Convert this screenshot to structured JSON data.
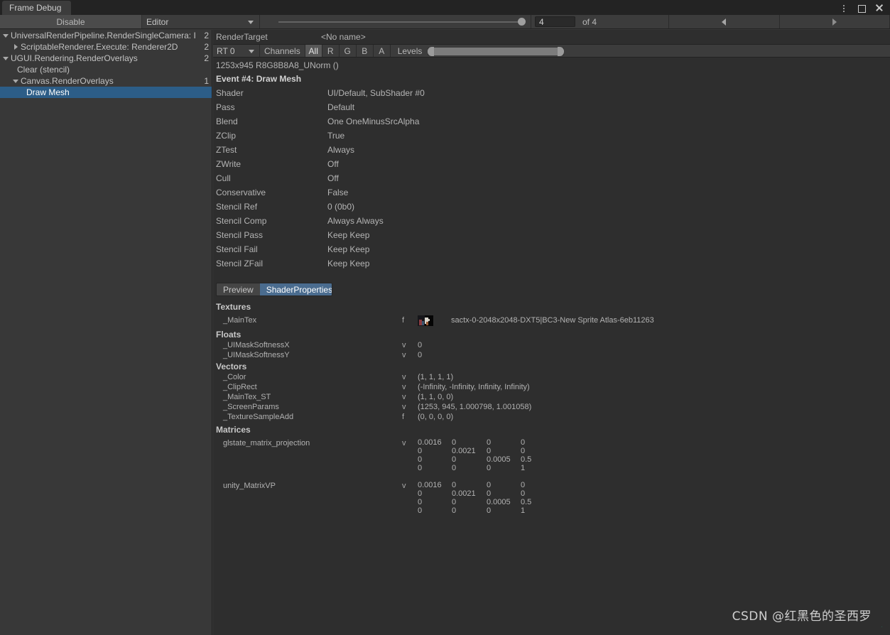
{
  "window": {
    "tab_title": "Frame Debug",
    "accent_color": "#19c39c",
    "selection_color": "#2c5d87",
    "panel_bg": "#2e2e2e",
    "buttons": {
      "menu": "kebab-menu",
      "maximize": "maximize",
      "close": "close"
    }
  },
  "toolbar": {
    "disable_label": "Disable",
    "target_label": "Editor",
    "event_index": "4",
    "event_total": "of 4",
    "prev_label": "◀",
    "next_label": "▶"
  },
  "tree": {
    "items": [
      {
        "label": "UniversalRenderPipeline.RenderSingleCamera: I",
        "count": "2",
        "indent": 0,
        "arrow": "down",
        "selected": false
      },
      {
        "label": "ScriptableRenderer.Execute: Renderer2D",
        "count": "2",
        "indent": 1,
        "arrow": "right",
        "selected": false
      },
      {
        "label": "UGUI.Rendering.RenderOverlays",
        "count": "2",
        "indent": 0,
        "arrow": "down",
        "selected": false
      },
      {
        "label": "Clear (stencil)",
        "count": "",
        "indent": 1,
        "arrow": "none",
        "selected": false
      },
      {
        "label": "Canvas.RenderOverlays",
        "count": "1",
        "indent": 1,
        "arrow": "down",
        "selected": false
      },
      {
        "label": "Draw Mesh",
        "count": "",
        "indent": 2,
        "arrow": "none",
        "selected": true
      }
    ]
  },
  "render_target": {
    "title": "RenderTarget",
    "name": "<No name>",
    "rt_select": "RT 0",
    "channels_label": "Channels",
    "channels": [
      "All",
      "R",
      "G",
      "B",
      "A"
    ],
    "channel_active": "All",
    "levels_label": "Levels",
    "info": "1253x945 R8G8B8A8_UNorm ()",
    "event_title": "Event #4: Draw Mesh"
  },
  "properties": [
    {
      "key": "Shader",
      "value": "UI/Default, SubShader #0"
    },
    {
      "key": "Pass",
      "value": "Default"
    },
    {
      "key": "Blend",
      "value": "One OneMinusSrcAlpha"
    },
    {
      "key": "ZClip",
      "value": "True"
    },
    {
      "key": "ZTest",
      "value": "Always"
    },
    {
      "key": "ZWrite",
      "value": "Off"
    },
    {
      "key": "Cull",
      "value": "Off"
    },
    {
      "key": "Conservative",
      "value": "False"
    },
    {
      "key": "Stencil Ref",
      "value": "0 (0b0)"
    },
    {
      "key": "Stencil Comp",
      "value": "Always Always"
    },
    {
      "key": "Stencil Pass",
      "value": "Keep Keep"
    },
    {
      "key": "Stencil Fail",
      "value": "Keep Keep"
    },
    {
      "key": "Stencil ZFail",
      "value": "Keep Keep"
    }
  ],
  "tabs": {
    "preview": "Preview",
    "shader_properties": "ShaderProperties",
    "active": "ShaderProperties"
  },
  "shader_properties": {
    "textures_header": "Textures",
    "textures": [
      {
        "name": "_MainTex",
        "type": "f",
        "value": "sactx-0-2048x2048-DXT5|BC3-New Sprite Atlas-6eb11263"
      }
    ],
    "floats_header": "Floats",
    "floats": [
      {
        "name": "_UIMaskSoftnessX",
        "type": "v",
        "value": "0"
      },
      {
        "name": "_UIMaskSoftnessY",
        "type": "v",
        "value": "0"
      }
    ],
    "vectors_header": "Vectors",
    "vectors": [
      {
        "name": "_Color",
        "type": "v",
        "value": "(1, 1, 1, 1)"
      },
      {
        "name": "_ClipRect",
        "type": "v",
        "value": "(-Infinity, -Infinity, Infinity, Infinity)"
      },
      {
        "name": "_MainTex_ST",
        "type": "v",
        "value": "(1, 1, 0, 0)"
      },
      {
        "name": "_ScreenParams",
        "type": "v",
        "value": "(1253, 945, 1.000798, 1.001058)"
      },
      {
        "name": "_TextureSampleAdd",
        "type": "f",
        "value": "(0, 0, 0, 0)"
      }
    ],
    "matrices_header": "Matrices",
    "matrices": [
      {
        "name": "glstate_matrix_projection",
        "type": "v",
        "rows": [
          [
            "0.0016",
            "0",
            "0",
            "0"
          ],
          [
            "0",
            "0.0021",
            "0",
            "0"
          ],
          [
            "0",
            "0",
            "0.0005",
            "0.5"
          ],
          [
            "0",
            "0",
            "0",
            "1"
          ]
        ]
      },
      {
        "name": "unity_MatrixVP",
        "type": "v",
        "rows": [
          [
            "0.0016",
            "0",
            "0",
            "0"
          ],
          [
            "0",
            "0.0021",
            "0",
            "0"
          ],
          [
            "0",
            "0",
            "0.0005",
            "0.5"
          ],
          [
            "0",
            "0",
            "0",
            "1"
          ]
        ]
      }
    ]
  },
  "watermark": {
    "text": "CSDN @红黑色的圣西罗"
  }
}
